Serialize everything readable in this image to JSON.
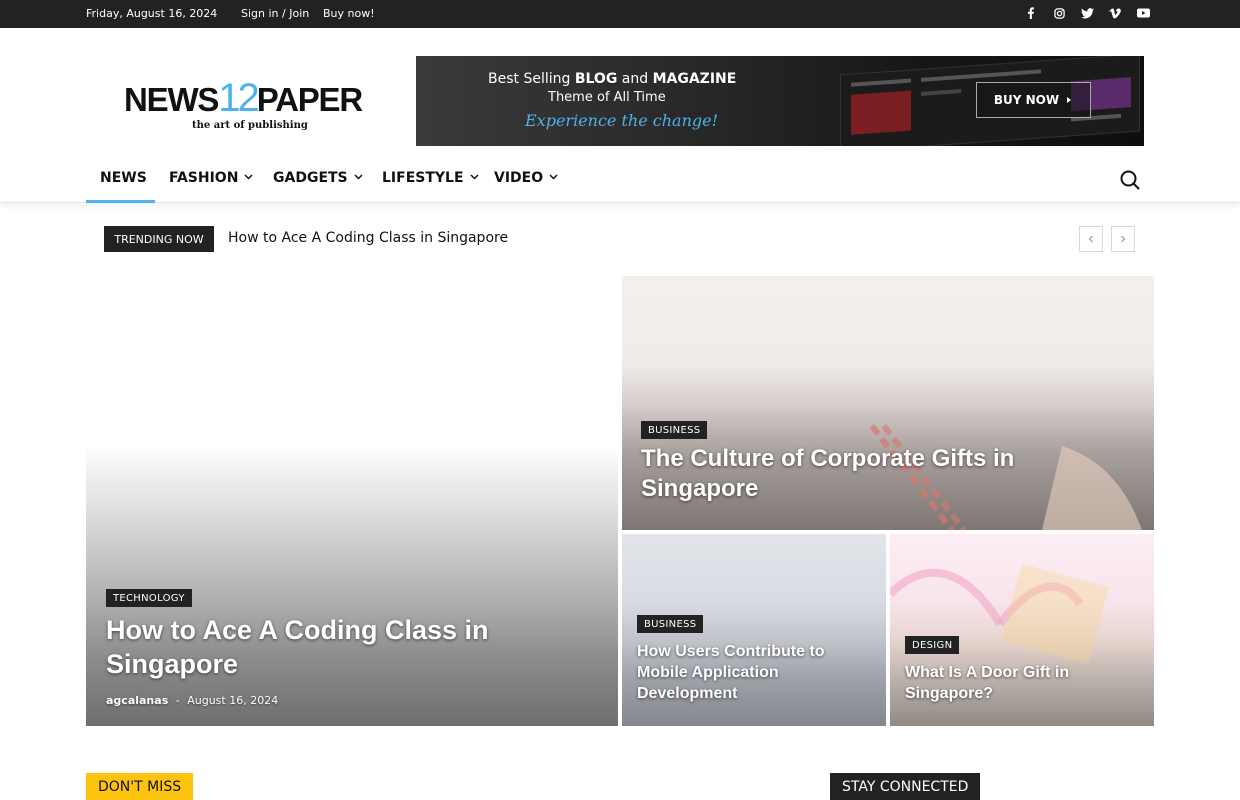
{
  "topbar": {
    "date": "Friday, August 16, 2024",
    "signin": "Sign in / Join",
    "buynow": "Buy now!",
    "social": [
      "facebook-icon",
      "instagram-icon",
      "twitter-icon",
      "vimeo-icon",
      "youtube-icon"
    ]
  },
  "logo": {
    "part1": "NEWS",
    "part2": "12",
    "part3": "PAPER",
    "tagline": "the art of publishing"
  },
  "banner": {
    "line1_a": "Best Selling ",
    "line1_b": "BLOG",
    "line1_c": " and ",
    "line1_d": "MAGAZINE",
    "line2": "Theme of All Time",
    "line3": "Experience the change!",
    "cta": "BUY NOW"
  },
  "nav": {
    "items": [
      "NEWS",
      "FASHION",
      "GADGETS",
      "LIFESTYLE",
      "VIDEO"
    ]
  },
  "trending": {
    "badge": "TRENDING NOW",
    "title": "How to Ace A Coding Class in Singapore"
  },
  "featured": {
    "main": {
      "category": "TECHNOLOGY",
      "title": "How to Ace A Coding Class in Singapore",
      "author": "agcalanas",
      "separator": "-",
      "date": "August 16, 2024"
    },
    "top_right": {
      "category": "BUSINESS",
      "title": "The Culture of Corporate Gifts in Singapore"
    },
    "bottom_left": {
      "category": "BUSINESS",
      "title": "How Users Contribute to Mobile Application Development"
    },
    "bottom_right": {
      "category": "DESIGN",
      "title": "What Is A Door Gift in Singapore?"
    }
  },
  "sections": {
    "dont_miss": "DON'T MISS",
    "stay_connected": "STAY CONNECTED"
  },
  "colors": {
    "accent": "#4db2ec",
    "dont_miss_bg": "#fdc40f",
    "dark": "#222222"
  }
}
